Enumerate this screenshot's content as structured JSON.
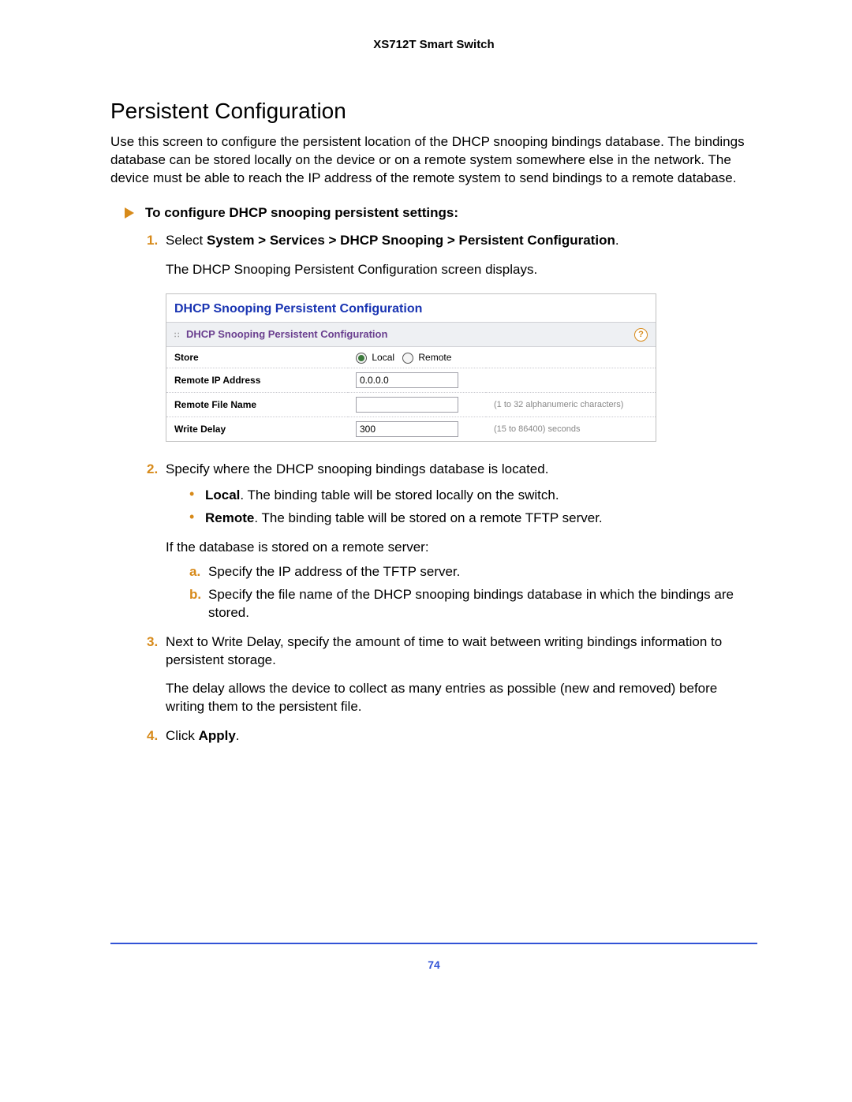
{
  "header": {
    "product": "XS712T Smart Switch"
  },
  "section": {
    "title": "Persistent Configuration",
    "intro": "Use this screen to configure the persistent location of the DHCP snooping bindings database. The bindings database can be stored locally on the device or on a remote system somewhere else in the network. The device must be able to reach the IP address of the remote system to send bindings to a remote database."
  },
  "task": {
    "heading": "To configure DHCP snooping persistent settings:"
  },
  "steps": {
    "s1": {
      "num": "1.",
      "pre": "Select ",
      "nav": "System > Services > DHCP Snooping > Persistent Configuration",
      "post": ".",
      "followup": "The DHCP Snooping Persistent Configuration screen displays."
    },
    "s2": {
      "num": "2.",
      "text": "Specify where the DHCP snooping bindings database is located.",
      "bullet_local_label": "Local",
      "bullet_local_desc": ". The binding table will be stored locally on the switch.",
      "bullet_remote_label": "Remote",
      "bullet_remote_desc": ". The binding table will be stored on a remote TFTP server.",
      "cond": "If the database is stored on a remote server:",
      "a_lbl": "a.",
      "a_txt": "Specify the IP address of the TFTP server.",
      "b_lbl": "b.",
      "b_txt": "Specify the file name of the DHCP snooping bindings database in which the bindings are stored."
    },
    "s3": {
      "num": "3.",
      "text": "Next to Write Delay, specify the amount of time to wait between writing bindings information to persistent storage.",
      "para": "The delay allows the device to collect as many entries as possible (new and removed) before writing them to the persistent file."
    },
    "s4": {
      "num": "4.",
      "pre": "Click ",
      "btn": "Apply",
      "post": "."
    }
  },
  "panel": {
    "title_main": "DHCP Snooping Persistent Configuration",
    "title_sub": "DHCP Snooping Persistent Configuration",
    "help": "?",
    "rows": {
      "store": {
        "label": "Store",
        "opt_local": "Local",
        "opt_remote": "Remote"
      },
      "ip": {
        "label": "Remote IP Address",
        "value": "0.0.0.0"
      },
      "file": {
        "label": "Remote File Name",
        "value": "",
        "hint": "(1 to 32 alphanumeric characters)"
      },
      "delay": {
        "label": "Write Delay",
        "value": "300",
        "hint": "(15 to 86400) seconds"
      }
    }
  },
  "footer": {
    "page": "74"
  }
}
